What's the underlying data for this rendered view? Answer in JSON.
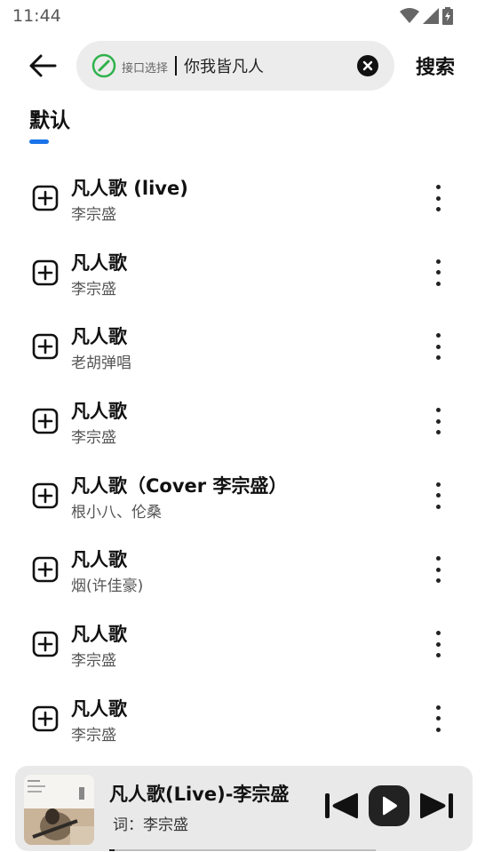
{
  "status_bar": {
    "time": "11:44"
  },
  "search": {
    "source_label": "接口选择",
    "query": "你我皆凡人",
    "submit_label": "搜索"
  },
  "tabs": [
    {
      "label": "默认",
      "active": true
    }
  ],
  "colors": {
    "accent": "#1a73e8",
    "source_icon": "#2fb24c"
  },
  "songs": [
    {
      "title": "凡人歌 (live)",
      "artist": "李宗盛"
    },
    {
      "title": "凡人歌",
      "artist": "李宗盛"
    },
    {
      "title": "凡人歌",
      "artist": "老胡弹唱"
    },
    {
      "title": "凡人歌",
      "artist": "李宗盛"
    },
    {
      "title": "凡人歌（Cover 李宗盛）",
      "artist": "根小八、伦桑"
    },
    {
      "title": "凡人歌",
      "artist": "烟(许佳豪)"
    },
    {
      "title": "凡人歌",
      "artist": "李宗盛"
    },
    {
      "title": "凡人歌",
      "artist": "李宗盛"
    }
  ],
  "player": {
    "title": "凡人歌(Live)-李宗盛",
    "lyric": "词：李宗盛",
    "progress": 0.02
  },
  "icons": {
    "back": "arrow-left-icon",
    "source": "link-icon",
    "clear": "close-circle-icon",
    "add": "plus-square-icon",
    "more": "more-vertical-icon",
    "prev": "skip-previous-icon",
    "play": "play-icon",
    "next": "skip-next-icon"
  }
}
